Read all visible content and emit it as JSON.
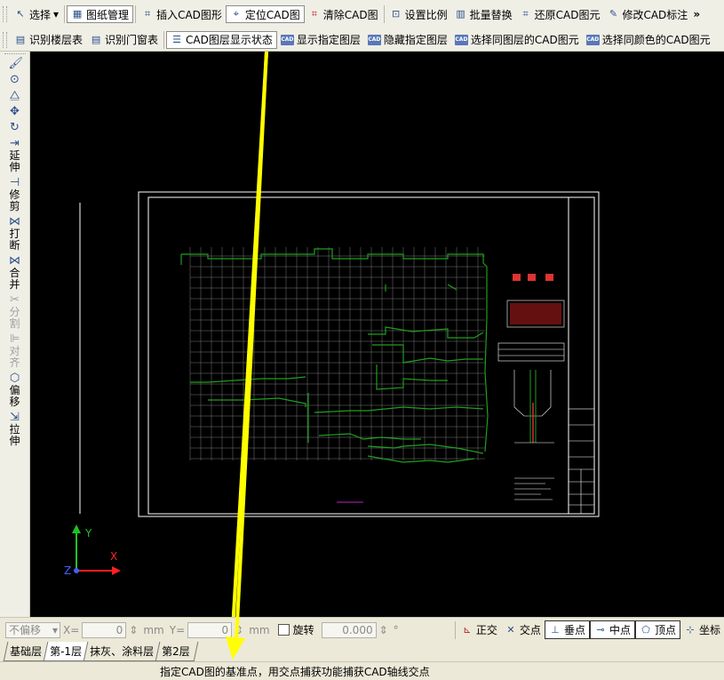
{
  "toolbar1": {
    "select": "选择",
    "drawing_manage": "图纸管理",
    "insert_cad": "插入CAD图形",
    "locate_cad": "定位CAD图",
    "clear_cad": "清除CAD图",
    "set_scale": "设置比例",
    "batch_replace": "批量替换",
    "restore_cad": "还原CAD图元",
    "modify_cad_dim": "修改CAD标注",
    "more": "»"
  },
  "toolbar2": {
    "identify_floor_table": "识别楼层表",
    "identify_door_window_table": "识别门窗表",
    "cad_layer_display": "CAD图层显示状态",
    "show_layer": "显示指定图层",
    "hide_layer": "隐藏指定图层",
    "select_same_layer": "选择同图层的CAD图元",
    "select_same_color": "选择同颜色的CAD图元",
    "cad_badge": "CAD"
  },
  "left_toolbar": {
    "extend": [
      "延",
      "伸"
    ],
    "trim": [
      "修",
      "剪"
    ],
    "break": [
      "打",
      "断"
    ],
    "merge": [
      "合",
      "并"
    ],
    "split": [
      "分",
      "割"
    ],
    "align": [
      "对",
      "齐"
    ],
    "offset": [
      "偏",
      "移"
    ],
    "stretch": [
      "拉",
      "伸"
    ]
  },
  "canvas": {
    "axis_y": "Y",
    "axis_x": "X",
    "axis_z": "Z"
  },
  "bottom_bar": {
    "offset_mode": "不偏移",
    "x_label": "X=",
    "x_value": "0",
    "y_label": "Y=",
    "y_value": "0",
    "unit": "mm",
    "rotate_label": "旋转",
    "rotate_value": "0.000",
    "degree": "°",
    "ortho": "正交",
    "intersection": "交点",
    "perpendicular": "垂点",
    "midpoint": "中点",
    "vertex": "顶点",
    "coordinate": "坐标"
  },
  "floor_tabs": [
    "基础层",
    "第-1层",
    "抹灰、涂料层",
    "第2层"
  ],
  "status_message": "指定CAD图的基准点，用交点捕获功能捕获CAD轴线交点",
  "colors": {
    "canvas_bg": "#000000",
    "cad_green": "#1f9e1f",
    "cad_white": "#ffffff",
    "arrow_yellow": "#ffff00",
    "axis_x": "#ff2020",
    "axis_y": "#20c020",
    "axis_z": "#4060ff"
  }
}
